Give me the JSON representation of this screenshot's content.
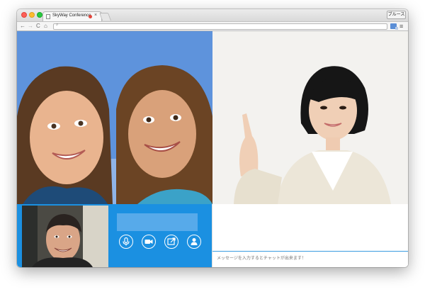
{
  "browser": {
    "tab_title": "SkyWay Conference",
    "profile_label": "ブルース",
    "url": ""
  },
  "chat": {
    "placeholder": "メッセージを入力するとチャットが出来ます！"
  },
  "colors": {
    "accent": "#1b90e1",
    "name_box": "#57aaea",
    "recording_dot": "#e2453b"
  },
  "icons": {
    "controls": [
      "microphone-icon",
      "camera-icon",
      "share-screen-icon",
      "add-user-icon"
    ]
  }
}
